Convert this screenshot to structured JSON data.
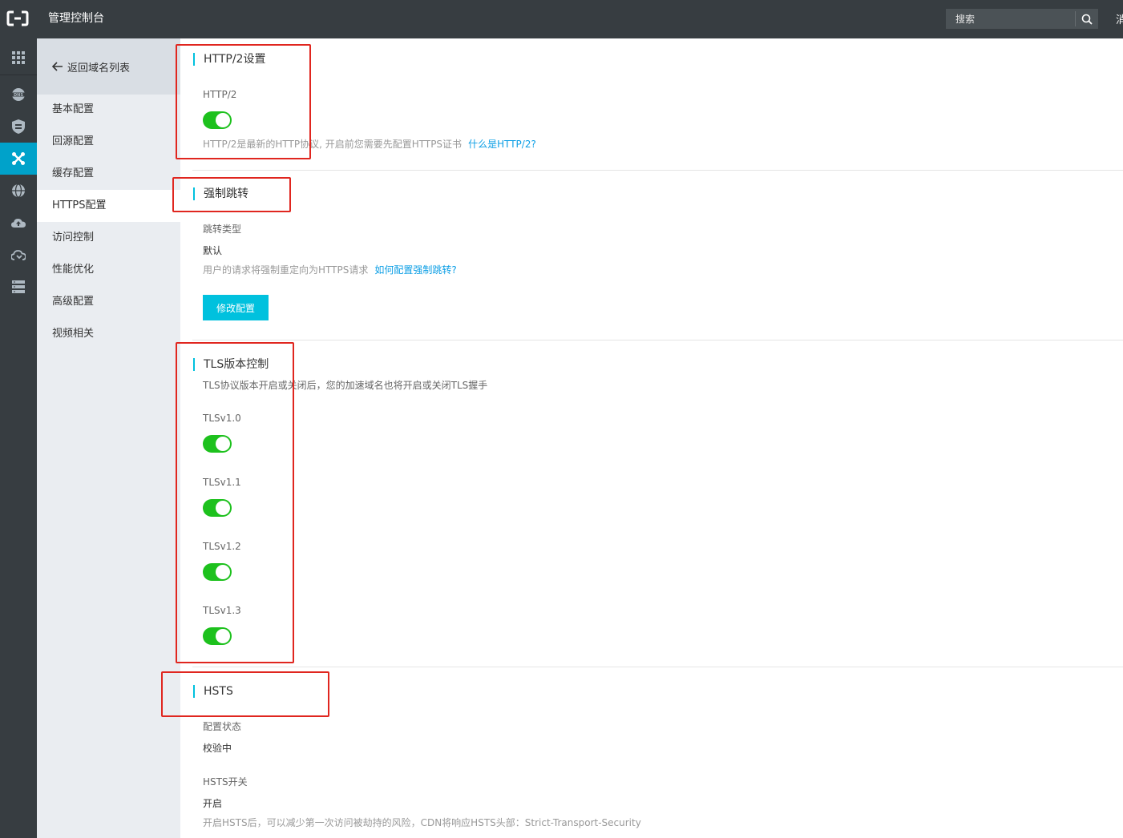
{
  "topbar": {
    "title": "管理控制台",
    "search_placeholder": "搜索",
    "extra_text": "消"
  },
  "sidebar_icons": [
    {
      "name": "grid-icon"
    },
    {
      "name": "dns-icon"
    },
    {
      "name": "shield-icon"
    },
    {
      "name": "cdn-icon",
      "active": true
    },
    {
      "name": "globe-icon"
    },
    {
      "name": "cloud-upload-icon"
    },
    {
      "name": "cloud-sync-icon"
    },
    {
      "name": "server-icon"
    }
  ],
  "subnav": {
    "back_label": "返回域名列表",
    "items": [
      {
        "label": "基本配置"
      },
      {
        "label": "回源配置"
      },
      {
        "label": "缓存配置"
      },
      {
        "label": "HTTPS配置",
        "active": true
      },
      {
        "label": "访问控制"
      },
      {
        "label": "性能优化"
      },
      {
        "label": "高级配置"
      },
      {
        "label": "视频相关"
      }
    ]
  },
  "http2": {
    "title": "HTTP/2设置",
    "label": "HTTP/2",
    "enabled": true,
    "desc": "HTTP/2是最新的HTTP协议, 开启前您需要先配置HTTPS证书",
    "link": "什么是HTTP/2?"
  },
  "redirect": {
    "title": "强制跳转",
    "type_label": "跳转类型",
    "type_value": "默认",
    "desc": "用户的请求将强制重定向为HTTPS请求",
    "link": "如何配置强制跳转?",
    "button": "修改配置"
  },
  "tls": {
    "title": "TLS版本控制",
    "desc": "TLS协议版本开启或关闭后，您的加速域名也将开启或关闭TLS握手",
    "versions": [
      {
        "label": "TLSv1.0",
        "enabled": true
      },
      {
        "label": "TLSv1.1",
        "enabled": true
      },
      {
        "label": "TLSv1.2",
        "enabled": true
      },
      {
        "label": "TLSv1.3",
        "enabled": true
      }
    ]
  },
  "hsts": {
    "title": "HSTS",
    "status_label": "配置状态",
    "status_value": "校验中",
    "switch_label": "HSTS开关",
    "switch_value": "开启",
    "desc": "开启HSTS后，可以减少第一次访问被劫持的风险，CDN将响应HSTS头部：Strict-Transport-Security"
  },
  "colors": {
    "topbar": "#373d41",
    "accent": "#00c1de",
    "switch_on": "#1dc11d",
    "link": "#0b9ee5",
    "annotation": "#e0261f"
  }
}
